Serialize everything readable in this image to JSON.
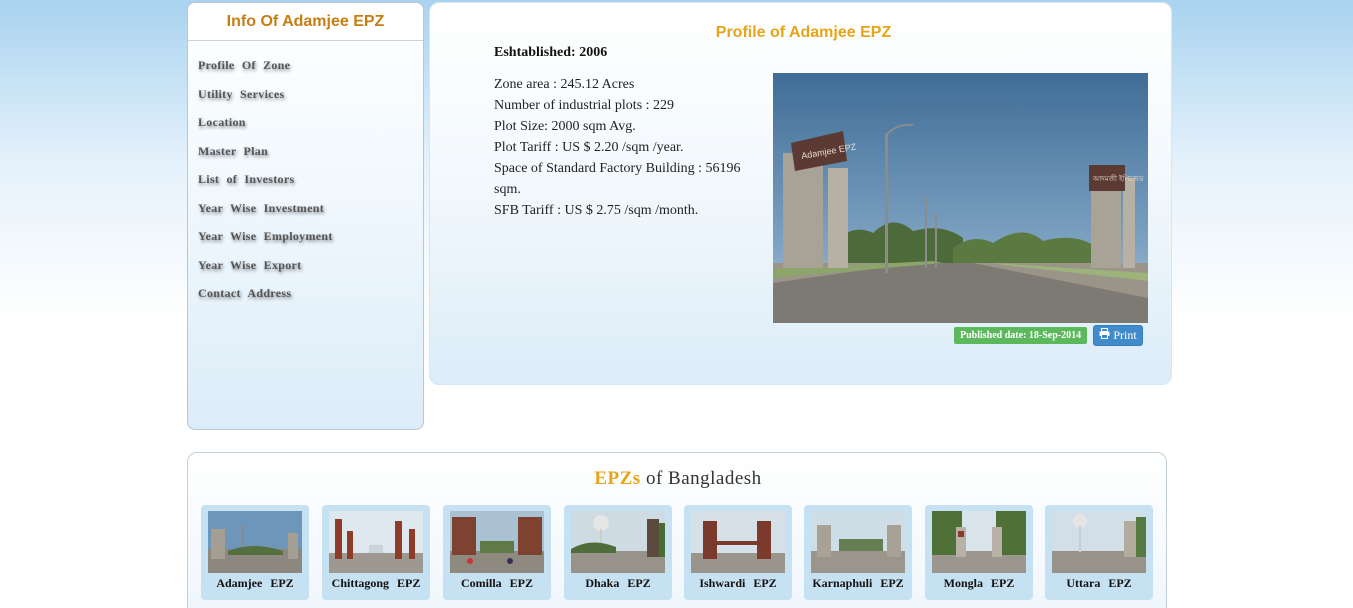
{
  "sidebar": {
    "title": "Info Of Adamjee EPZ",
    "items": [
      {
        "label": "Profile  Of  Zone"
      },
      {
        "label": "Utility  Services"
      },
      {
        "label": "Location"
      },
      {
        "label": "Master  Plan"
      },
      {
        "label": "List  of  Investors"
      },
      {
        "label": "Year  Wise  Investment"
      },
      {
        "label": "Year  Wise  Employment"
      },
      {
        "label": "Year  Wise  Export"
      },
      {
        "label": "Contact  Address"
      }
    ]
  },
  "profile": {
    "title": "Profile of Adamjee EPZ",
    "established": "Eshtablished: 2006",
    "facts": [
      "Zone area : 245.12 Acres",
      "Number of industrial plots : 229",
      "Plot Size: 2000 sqm Avg.",
      "Plot Tariff : US $ 2.20 /sqm /year.",
      "Space of Standard Factory Building : 56196 sqm.",
      "SFB Tariff : US $ 2.75 /sqm /month."
    ],
    "published": "Published date: 18-Sep-2014",
    "print_label": "Print",
    "gate_sign_left": "Adamjee EPZ",
    "gate_sign_right": "আদমজী ইপিজেড"
  },
  "epzs": {
    "heading_highlight": "EPZs",
    "heading_rest": "of  Bangladesh",
    "items": [
      {
        "label": "Adamjee  EPZ"
      },
      {
        "label": "Chittagong  EPZ"
      },
      {
        "label": "Comilla  EPZ"
      },
      {
        "label": "Dhaka  EPZ"
      },
      {
        "label": "Ishwardi  EPZ"
      },
      {
        "label": "Karnaphuli  EPZ"
      },
      {
        "label": "Mongla  EPZ"
      },
      {
        "label": "Uttara  EPZ"
      }
    ]
  },
  "colors": {
    "accent_orange": "#e8a317",
    "title_orange": "#c77d10",
    "badge_green": "#5cb85c",
    "print_blue": "#428bca"
  },
  "icons": [
    "printer-icon"
  ]
}
